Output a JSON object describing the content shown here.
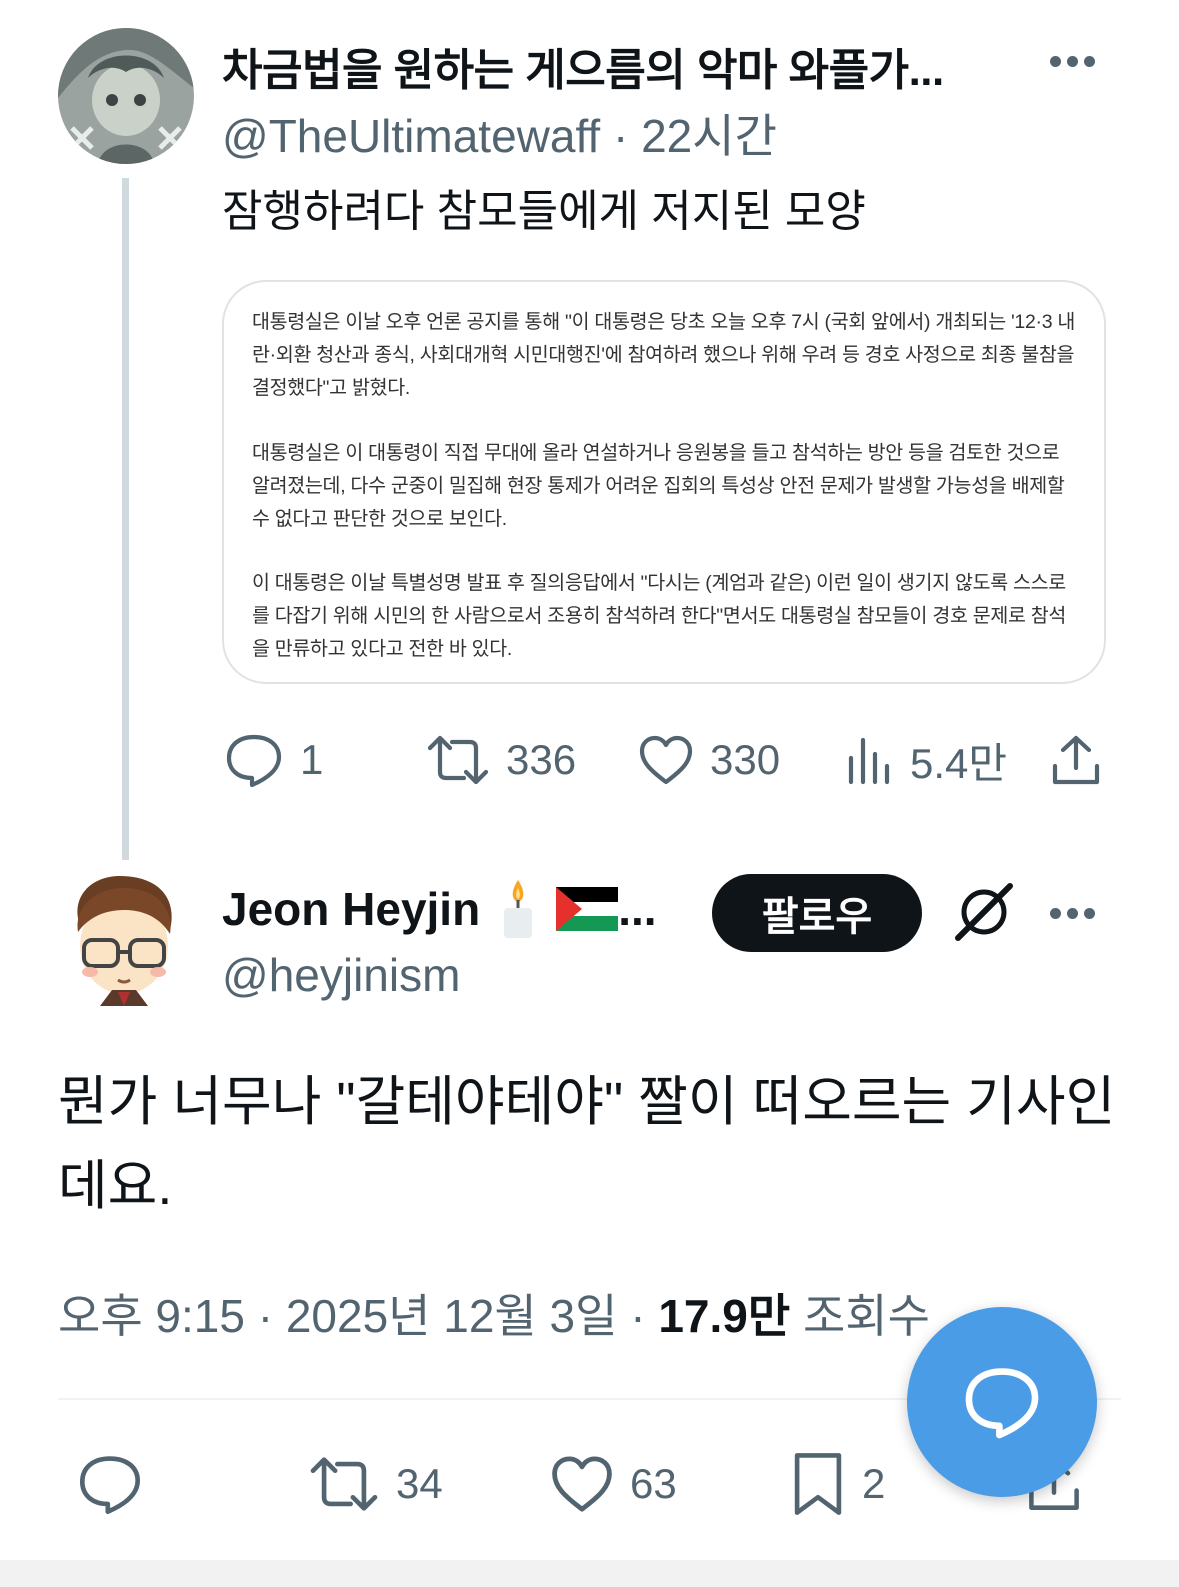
{
  "parent_tweet": {
    "display_name": "차금법을 원하는 게으름의 악마 와플가...",
    "handle": "@TheUltimatewaff",
    "time": "· 22시간",
    "text": "잠행하려다 참모들에게 저지된 모양",
    "article_paragraphs": [
      "대통령실은 이날 오후 언론 공지를 통해 \"이 대통령은 당초 오늘 오후 7시 (국회 앞에서) 개최되는 '12·3 내란·외환 청산과 종식, 사회대개혁 시민대행진'에 참여하려 했으나 위해 우려 등 경호 사정으로 최종 불참을 결정했다\"고 밝혔다.",
      "대통령실은 이 대통령이 직접 무대에 올라 연설하거나 응원봉을 들고 참석하는 방안 등을 검토한 것으로 알려졌는데, 다수 군중이 밀집해 현장 통제가 어려운 집회의 특성상 안전 문제가 발생할 가능성을 배제할 수 없다고 판단한 것으로 보인다.",
      "이 대통령은 이날 특별성명 발표 후 질의응답에서 \"다시는 (계엄과 같은) 이런 일이 생기지 않도록 스스로를 다잡기 위해 시민의 한 사람으로서 조용히 참석하려 한다\"면서도 대통령실 참모들이 경호 문제로 참석을 만류하고 있다고 전한 바 있다."
    ],
    "stats": {
      "replies": "1",
      "retweets": "336",
      "likes": "330",
      "views": "5.4만"
    }
  },
  "main_tweet": {
    "display_name": "Jeon Heyjin",
    "name_suffix": "...",
    "emoji_icons": [
      "candle-icon",
      "palestine-flag-icon"
    ],
    "follow_label": "팔로우",
    "handle": "@heyjinism",
    "text": "뭔가 너무나 \"갈테야테야\" 짤이 떠오르는 기사인데요.",
    "timestamp": "오후 9:15 · 2025년 12월 3일 · ",
    "views_count": "17.9만",
    "views_label": " 조회수",
    "stats": {
      "retweets": "34",
      "likes": "63",
      "bookmarks": "2"
    }
  },
  "colors": {
    "accent": "#4b9ce6",
    "text": "#0f1419",
    "muted": "#536471",
    "follow_bg": "#0f1419"
  }
}
